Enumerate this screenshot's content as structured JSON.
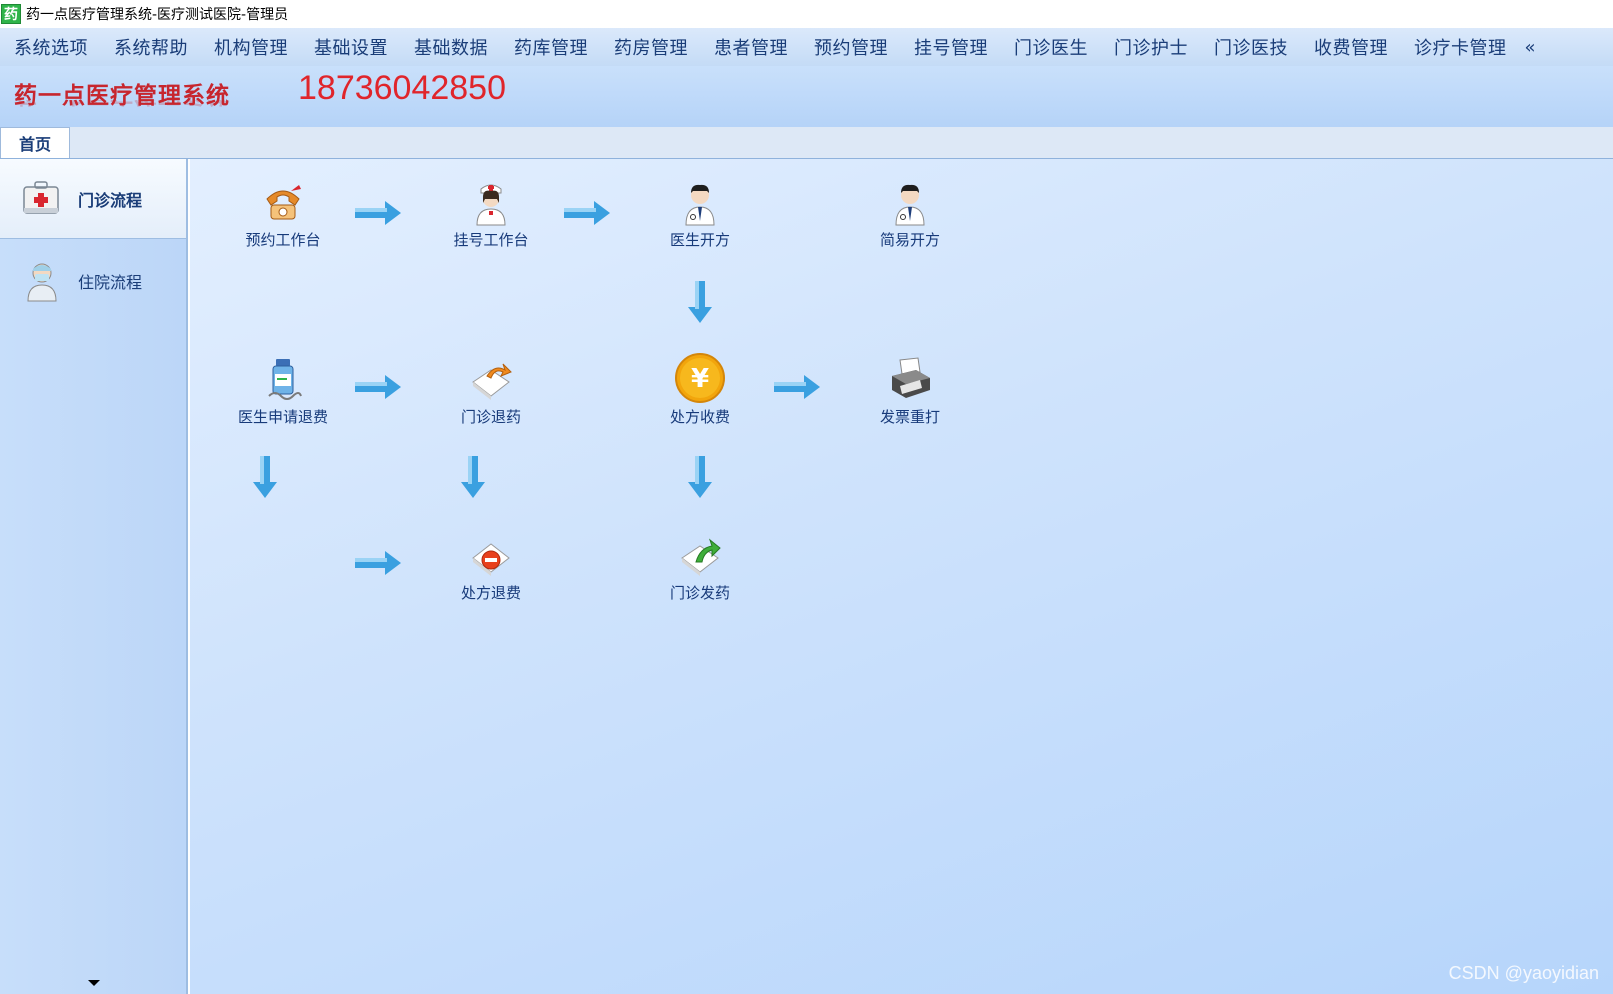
{
  "window": {
    "icon_char": "药",
    "title": "药一点医疗管理系统-医疗测试医院-管理员"
  },
  "menu": {
    "items": [
      "系统选项",
      "系统帮助",
      "机构管理",
      "基础设置",
      "基础数据",
      "药库管理",
      "药房管理",
      "患者管理",
      "预约管理",
      "挂号管理",
      "门诊医生",
      "门诊护士",
      "门诊医技",
      "收费管理",
      "诊疗卡管理"
    ]
  },
  "banner": {
    "brand": "药一点医疗管理系统",
    "phone": "18736042850"
  },
  "tabs": {
    "home": "首页"
  },
  "sidebar": {
    "items": [
      {
        "label": "门诊流程",
        "icon": "medical-kit-icon"
      },
      {
        "label": "住院流程",
        "icon": "doctor-mask-icon"
      }
    ]
  },
  "flow": {
    "nodes": {
      "appointment": "预约工作台",
      "registration": "挂号工作台",
      "doctor_prescribe": "医生开方",
      "simple_prescribe": "简易开方",
      "doctor_refund_request": "医生申请退费",
      "clinic_return_drug": "门诊退药",
      "prescription_charge": "处方收费",
      "invoice_reprint": "发票重打",
      "prescription_refund": "处方退费",
      "clinic_dispense": "门诊发药"
    }
  },
  "watermark": "CSDN @yaoyidian",
  "colors": {
    "menu_text": "#1a3d78",
    "brand_red": "#c7262e",
    "phone_red": "#e0252b",
    "arrow_blue": "#3aa0e0"
  }
}
